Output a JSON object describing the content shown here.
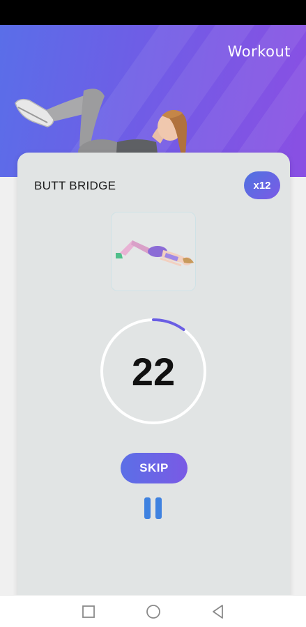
{
  "header": {
    "title": "Workout"
  },
  "exercise": {
    "name": "BUTT BRIDGE",
    "reps": "x12"
  },
  "timer": {
    "value": "22",
    "progress_fraction": 0.1
  },
  "controls": {
    "skip_label": "SKIP",
    "pause_icon": "pause-icon"
  },
  "navigation": {
    "recents_icon": "square-icon",
    "home_icon": "circle-icon",
    "back_icon": "triangle-back-icon"
  },
  "colors": {
    "accent_start": "#5b6fe6",
    "accent_end": "#7a5ae5",
    "card_background": "#e1e4e4",
    "pause_blue": "#3f82e0"
  }
}
